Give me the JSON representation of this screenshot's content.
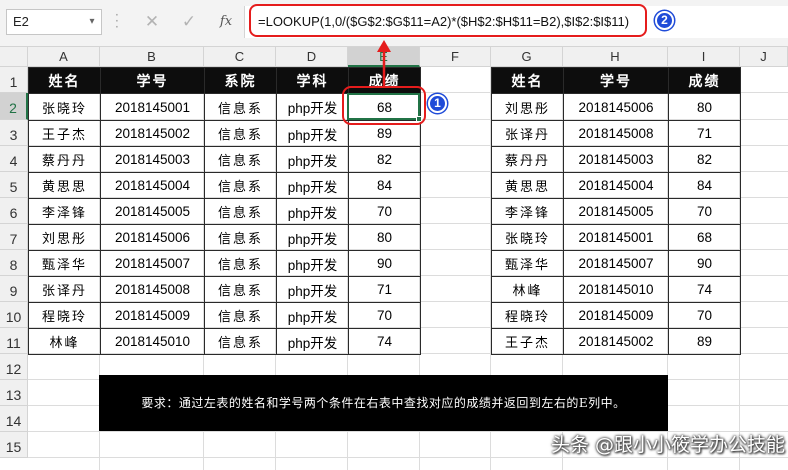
{
  "formula_bar": {
    "name_box": "E2",
    "cancel_glyph": "✕",
    "enter_glyph": "✓",
    "fx_label": "fx",
    "formula": "=LOOKUP(1,0/($G$2:$G$11=A2)*($H$2:$H$11=B2),$I$2:$I$11)"
  },
  "columns": [
    "A",
    "B",
    "C",
    "D",
    "E",
    "F",
    "G",
    "H",
    "I",
    "J"
  ],
  "rows": [
    "1",
    "2",
    "3",
    "4",
    "5",
    "6",
    "7",
    "8",
    "9",
    "10",
    "11",
    "12",
    "13",
    "14",
    "15"
  ],
  "selected_cell": {
    "column": "E",
    "row": "2"
  },
  "left_table": {
    "headers": [
      "姓名",
      "学号",
      "系院",
      "学科",
      "成绩"
    ],
    "rows": [
      [
        "张晓玲",
        "2018145001",
        "信息系",
        "php开发",
        "68"
      ],
      [
        "王子杰",
        "2018145002",
        "信息系",
        "php开发",
        "89"
      ],
      [
        "蔡丹丹",
        "2018145003",
        "信息系",
        "php开发",
        "82"
      ],
      [
        "黄思思",
        "2018145004",
        "信息系",
        "php开发",
        "84"
      ],
      [
        "李泽锋",
        "2018145005",
        "信息系",
        "php开发",
        "70"
      ],
      [
        "刘思彤",
        "2018145006",
        "信息系",
        "php开发",
        "80"
      ],
      [
        "甄泽华",
        "2018145007",
        "信息系",
        "php开发",
        "90"
      ],
      [
        "张译丹",
        "2018145008",
        "信息系",
        "php开发",
        "71"
      ],
      [
        "程晓玲",
        "2018145009",
        "信息系",
        "php开发",
        "70"
      ],
      [
        "林峰",
        "2018145010",
        "信息系",
        "php开发",
        "74"
      ]
    ]
  },
  "right_table": {
    "headers": [
      "姓名",
      "学号",
      "成绩"
    ],
    "rows": [
      [
        "刘思彤",
        "2018145006",
        "80"
      ],
      [
        "张译丹",
        "2018145008",
        "71"
      ],
      [
        "蔡丹丹",
        "2018145003",
        "82"
      ],
      [
        "黄思思",
        "2018145004",
        "84"
      ],
      [
        "李泽锋",
        "2018145005",
        "70"
      ],
      [
        "张晓玲",
        "2018145001",
        "68"
      ],
      [
        "甄泽华",
        "2018145007",
        "90"
      ],
      [
        "林峰",
        "2018145010",
        "74"
      ],
      [
        "程晓玲",
        "2018145009",
        "70"
      ],
      [
        "王子杰",
        "2018145002",
        "89"
      ]
    ]
  },
  "annotations": {
    "badge_1": "1",
    "badge_2": "2",
    "highlight_color": "#e51c1c",
    "badge_color": "#1f4bd8"
  },
  "requirement": "要求：通过左表的姓名和学号两个条件在右表中查找对应的成绩并返回到左右的E列中。",
  "watermark": "头条 @跟小小筱学办公技能",
  "colors": {
    "header_bg": "#0d0d0d",
    "header_fg": "#ffffff",
    "excel_green": "#217346"
  }
}
